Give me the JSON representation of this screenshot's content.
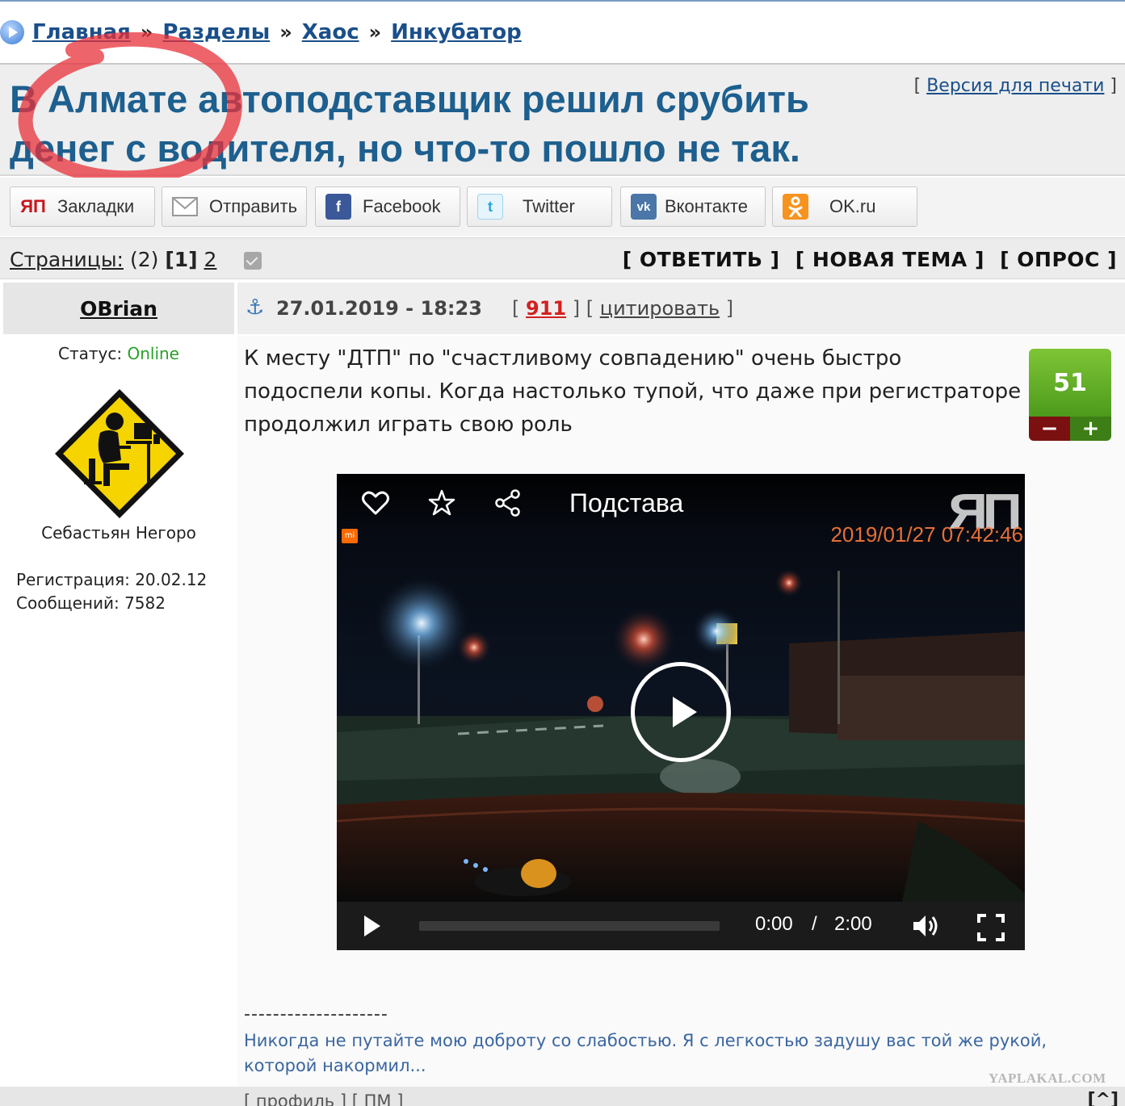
{
  "breadcrumb": {
    "items": [
      "Главная",
      "Разделы",
      "Хаос",
      "Инкубатор"
    ],
    "separator": "»"
  },
  "topic": {
    "title": "В Алмате автоподставщик решил срубить денег с водителя, но что-то пошло не так.",
    "print_label": "Версия для печати"
  },
  "share": {
    "buttons": [
      "Закладки",
      "Отправить",
      "Facebook",
      "Twitter",
      "Вконтакте",
      "OK.ru"
    ],
    "yp_short": "ЯП"
  },
  "pages": {
    "label": "Страницы:",
    "count": "(2)",
    "current": "[1]",
    "next": "2"
  },
  "actions": {
    "reply": "[ ОТВЕТИТЬ ]",
    "new_topic": "[ НОВАЯ ТЕМА ]",
    "poll": "[ ОПРОС ]"
  },
  "post": {
    "author": "OBrian",
    "date": "27.01.2019 - 18:23",
    "number": "911",
    "quote_label": "цитировать",
    "status_label": "Статус:",
    "status_value": "Online",
    "avatar_caption": "Себастьян Негоро",
    "registration": "Регистрация: 20.02.12",
    "messages": "Сообщений: 7582",
    "text": "К месту \"ДТП\" по \"счастливому совпадению\" очень быстро подоспели копы. Когда настолько тупой, что даже при регистраторе продолжил играть свою роль",
    "rating": "51",
    "rating_minus": "−",
    "rating_plus": "+",
    "signature_dash": "--------------------",
    "signature": "Никогда не путайте мою доброту со слабостью. Я с легкостью задушу вас той же рукой, которой накормил..."
  },
  "video": {
    "title": "Подстава",
    "logo": "ЯП",
    "timestamp": "2019/01/27 07:42:46",
    "badge": "mi",
    "current_time": "0:00",
    "time_separator": "/",
    "duration": "2:00",
    "progress": 0
  },
  "footer": {
    "profile": "профиль",
    "pm": "ПМ",
    "to_top": "[^]"
  },
  "watermark": "YAPLAKAL.COM",
  "colors": {
    "title": "#1d5f8e",
    "link": "#1a4f8a",
    "online": "#2aa02a",
    "post_number": "#d42020",
    "rating_green": "#5aa826",
    "annotation_circle": "#e8303a"
  }
}
